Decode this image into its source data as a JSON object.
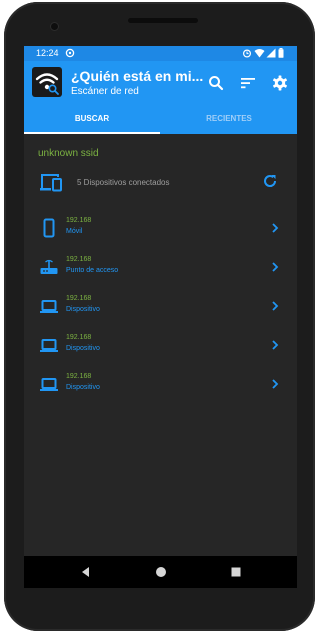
{
  "status_bar": {
    "time": "12:24",
    "icons": [
      "settings-sync-icon",
      "alarm-icon",
      "wifi-icon",
      "signal-icon",
      "battery-icon"
    ]
  },
  "app_bar": {
    "title": "¿Quién está en mi...",
    "subtitle": "Escáner de red",
    "actions": [
      "search-icon",
      "sort-icon",
      "settings-icon"
    ]
  },
  "tabs": [
    {
      "label": "BUSCAR",
      "active": true
    },
    {
      "label": "RECIENTES",
      "active": false
    }
  ],
  "network": {
    "ssid": "unknown ssid",
    "connected_summary": "5 Dispositivos conectados"
  },
  "devices": [
    {
      "ip": "192.168",
      "type": "Móvil",
      "icon": "smartphone-icon"
    },
    {
      "ip": "192.168",
      "type": "Punto de acceso",
      "icon": "router-icon"
    },
    {
      "ip": "192.168",
      "type": "Dispositivo",
      "icon": "laptop-icon"
    },
    {
      "ip": "192.168",
      "type": "Dispositivo",
      "icon": "laptop-icon"
    },
    {
      "ip": "192.168",
      "type": "Dispositivo",
      "icon": "laptop-icon"
    }
  ],
  "colors": {
    "primary": "#2196f3",
    "status_bar": "#1e88e5",
    "background": "#262626",
    "ssid_green": "#7cb342",
    "muted_text": "#9e9e9e"
  }
}
